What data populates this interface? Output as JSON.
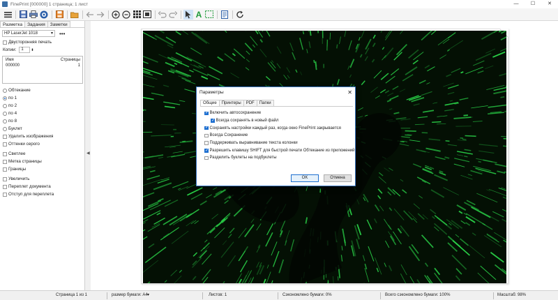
{
  "window": {
    "title": "FinePrint [000000] 1 страница; 1 лист",
    "controls": [
      "—",
      "☐",
      "✕"
    ]
  },
  "toolbar": {
    "buttons": [
      "menu-icon",
      "save-icon",
      "print-icon",
      "fineprint-icon",
      "save-as-icon",
      "open-folder-icon",
      "back-arrow-icon",
      "forward-arrow-icon",
      "zoom-in-icon",
      "zoom-out-icon",
      "grid-view-icon",
      "fit-page-icon",
      "undo-icon",
      "redo-icon",
      "select-arrow-icon",
      "text-tool-icon",
      "selection-rect-icon",
      "document-icon",
      "refresh-icon"
    ]
  },
  "left_panel": {
    "tabs": [
      "Разметка",
      "Задания",
      "Заметки"
    ],
    "printer": "HP LaserJet 1018",
    "printer_more": "•••",
    "duplex_label": "Двусторонняя печать",
    "copies_label": "Копии:",
    "copies_value": "1",
    "list_headers": [
      "Имя",
      "Страницы"
    ],
    "list_rows": [
      [
        "000000",
        "1"
      ]
    ],
    "radio_options": [
      "Обтекание",
      "по 1",
      "по 2",
      "по 4",
      "по 8",
      "Буклет"
    ],
    "check_options_1": [
      "Удалить изображения",
      "Оттенки серого"
    ],
    "check_options_2": [
      "Светлее",
      "Метка страницы",
      "Границы"
    ],
    "check_options_3": [
      "Увеличить",
      "Переплет документа",
      "Отступ для переплета"
    ]
  },
  "dialog": {
    "title": "Параметры",
    "tabs": [
      "Общие",
      "Принтеры",
      "PDF",
      "Папки"
    ],
    "options": [
      {
        "label": "Включить автосохранение",
        "checked": true,
        "indent": false
      },
      {
        "label": "Всегда сохранять в новый файл",
        "checked": true,
        "indent": true
      },
      {
        "label": "Сохранять настройки каждый раз, когда окно FinePrint закрывается",
        "checked": true,
        "indent": false
      },
      {
        "label": "Всегда Сохранение",
        "checked": false,
        "indent": false
      },
      {
        "label": "Поддерживать выравнивание текста колонки",
        "checked": false,
        "indent": false
      },
      {
        "label": "Разрешить клавишу SHIFT для быстрой печати Обтекание из приложений",
        "checked": true,
        "indent": false
      },
      {
        "label": "Разделить буклеты на подбуклеты",
        "checked": false,
        "indent": false
      }
    ],
    "ok_label": "OK",
    "cancel_label": "Отмена"
  },
  "status": {
    "page": "Страница 1 из 1",
    "paper_size": "размер бумаги: A4",
    "sheets": "Листов: 1",
    "saved_paper": "Сэкономлено бумаги: 0%",
    "total_saved": "Всего сэкономлено бумаги: 100%",
    "zoom": "Масштаб: 98%"
  },
  "colors": {
    "accent": "#1e6fd0",
    "matrix_green": "#2bd94a"
  }
}
